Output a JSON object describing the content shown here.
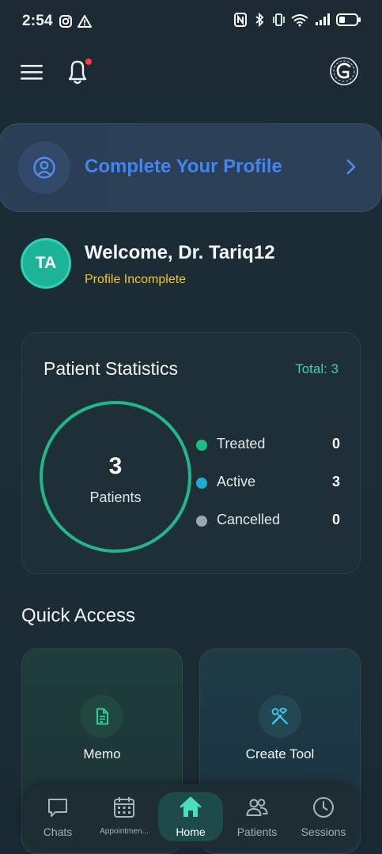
{
  "status_bar": {
    "time": "2:54",
    "left_icons": [
      "instagram-icon",
      "warning-icon"
    ],
    "right_icons": [
      "nfc-icon",
      "bluetooth-icon",
      "vibrate-icon",
      "wifi-icon",
      "signal-icon",
      "battery-icon"
    ]
  },
  "header": {
    "menu_icon": "hamburger-menu-icon",
    "notification_icon": "bell-icon",
    "has_unread": true,
    "logo_icon": "app-logo-icon"
  },
  "banner": {
    "title": "Complete Your Profile",
    "icon": "user-circle-icon"
  },
  "welcome": {
    "initials": "TA",
    "title": "Welcome, Dr. Tariq12",
    "status": "Profile Incomplete"
  },
  "stats": {
    "title": "Patient Statistics",
    "total_label": "Total: 3",
    "ring_value": "3",
    "ring_label": "Patients",
    "legend": [
      {
        "label": "Treated",
        "value": "0",
        "color": "#1dbb86"
      },
      {
        "label": "Active",
        "value": "3",
        "color": "#1aaed6"
      },
      {
        "label": "Cancelled",
        "value": "0",
        "color": "#9aa6b0"
      }
    ]
  },
  "quick_access": {
    "title": "Quick Access",
    "items": [
      {
        "label": "Memo",
        "icon": "document-icon"
      },
      {
        "label": "Create Tool",
        "icon": "tools-icon"
      }
    ]
  },
  "bottom_nav": {
    "items": [
      {
        "label": "Chats",
        "icon": "chat-icon"
      },
      {
        "label": "Appointmen...",
        "icon": "calendar-icon"
      },
      {
        "label": "Home",
        "icon": "home-icon",
        "active": true
      },
      {
        "label": "Patients",
        "icon": "users-icon"
      },
      {
        "label": "Sessions",
        "icon": "clock-icon"
      }
    ]
  },
  "colors": {
    "background": "#1c2b34",
    "accent_teal": "#3fd1b3",
    "accent_blue": "#3f86f3",
    "warning_yellow": "#f0c534",
    "notification_red": "#ff3b46"
  }
}
